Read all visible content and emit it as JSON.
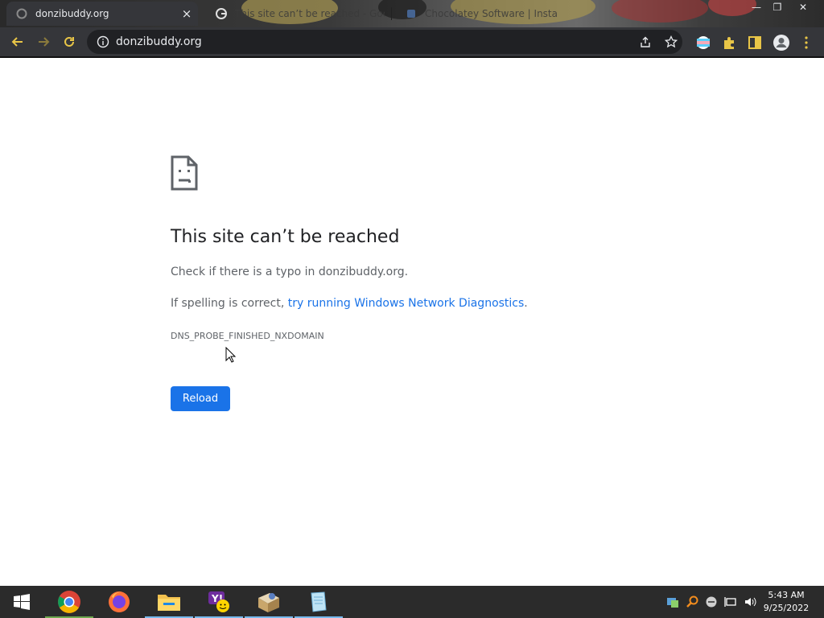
{
  "browser": {
    "tabs": [
      {
        "title": "donzibuddy.org",
        "active": true
      },
      {
        "title": "This site can’t be reached - Goo",
        "active": false
      },
      {
        "title": "Chocolatey Software | Installing",
        "active": false
      }
    ],
    "close_glyph": "×",
    "url": "donzibuddy.org"
  },
  "error": {
    "title": "This site can’t be reached",
    "typo_line": "Check if there is a typo in donzibuddy.org.",
    "spelling_prefix": "If spelling is correct, ",
    "diagnostics_link": "try running Windows Network Diagnostics",
    "spelling_suffix": ".",
    "code": "DNS_PROBE_FINISHED_NXDOMAIN",
    "reload_label": "Reload"
  },
  "taskbar": {
    "apps": [
      "Windows Start",
      "Google Chrome",
      "Firefox",
      "File Explorer",
      "Yahoo Messenger",
      "Installer",
      "Notepad"
    ],
    "time": "5:43 AM",
    "date": "9/25/2022"
  },
  "colors": {
    "accent": "#1a73e8",
    "toolbar": "#35363a",
    "omnibox": "#202124",
    "taskbar": "#2b2b2b"
  }
}
